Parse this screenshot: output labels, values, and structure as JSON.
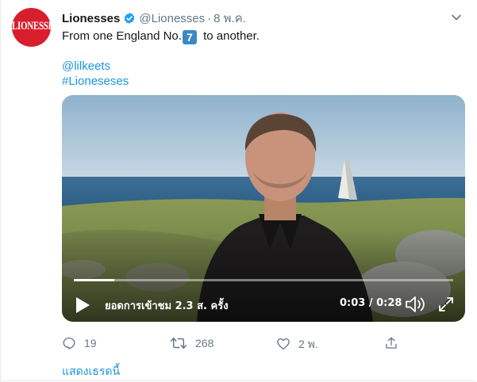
{
  "tweet": {
    "avatar_text": "LIONESSES",
    "name": "Lionesses",
    "handle": "@Lionesses",
    "separator": "·",
    "date": "8 พ.ค.",
    "text_before": "From one England No.",
    "keycap": "7",
    "text_after": " to another.",
    "mention": "@lilkeets",
    "hashtag": "#Lioneseses"
  },
  "video": {
    "views": "ยอดการเข้าชม 2.3 ส. ครั้ง",
    "time": "0:03 / 0:28",
    "progress": 0.107
  },
  "actions": {
    "replies": "19",
    "retweets": "268",
    "likes": "2 พ."
  },
  "thread_link": "แสดงเธรดนี้",
  "colors": {
    "brand_red": "#d81e2c",
    "link_blue": "#1b95e0",
    "muted_gray": "#657786",
    "verified_blue": "#1da1f2"
  },
  "icons": [
    "verified-badge-icon",
    "chevron-down-icon",
    "play-icon",
    "volume-icon",
    "fullscreen-icon",
    "reply-icon",
    "retweet-icon",
    "like-icon",
    "share-icon"
  ]
}
